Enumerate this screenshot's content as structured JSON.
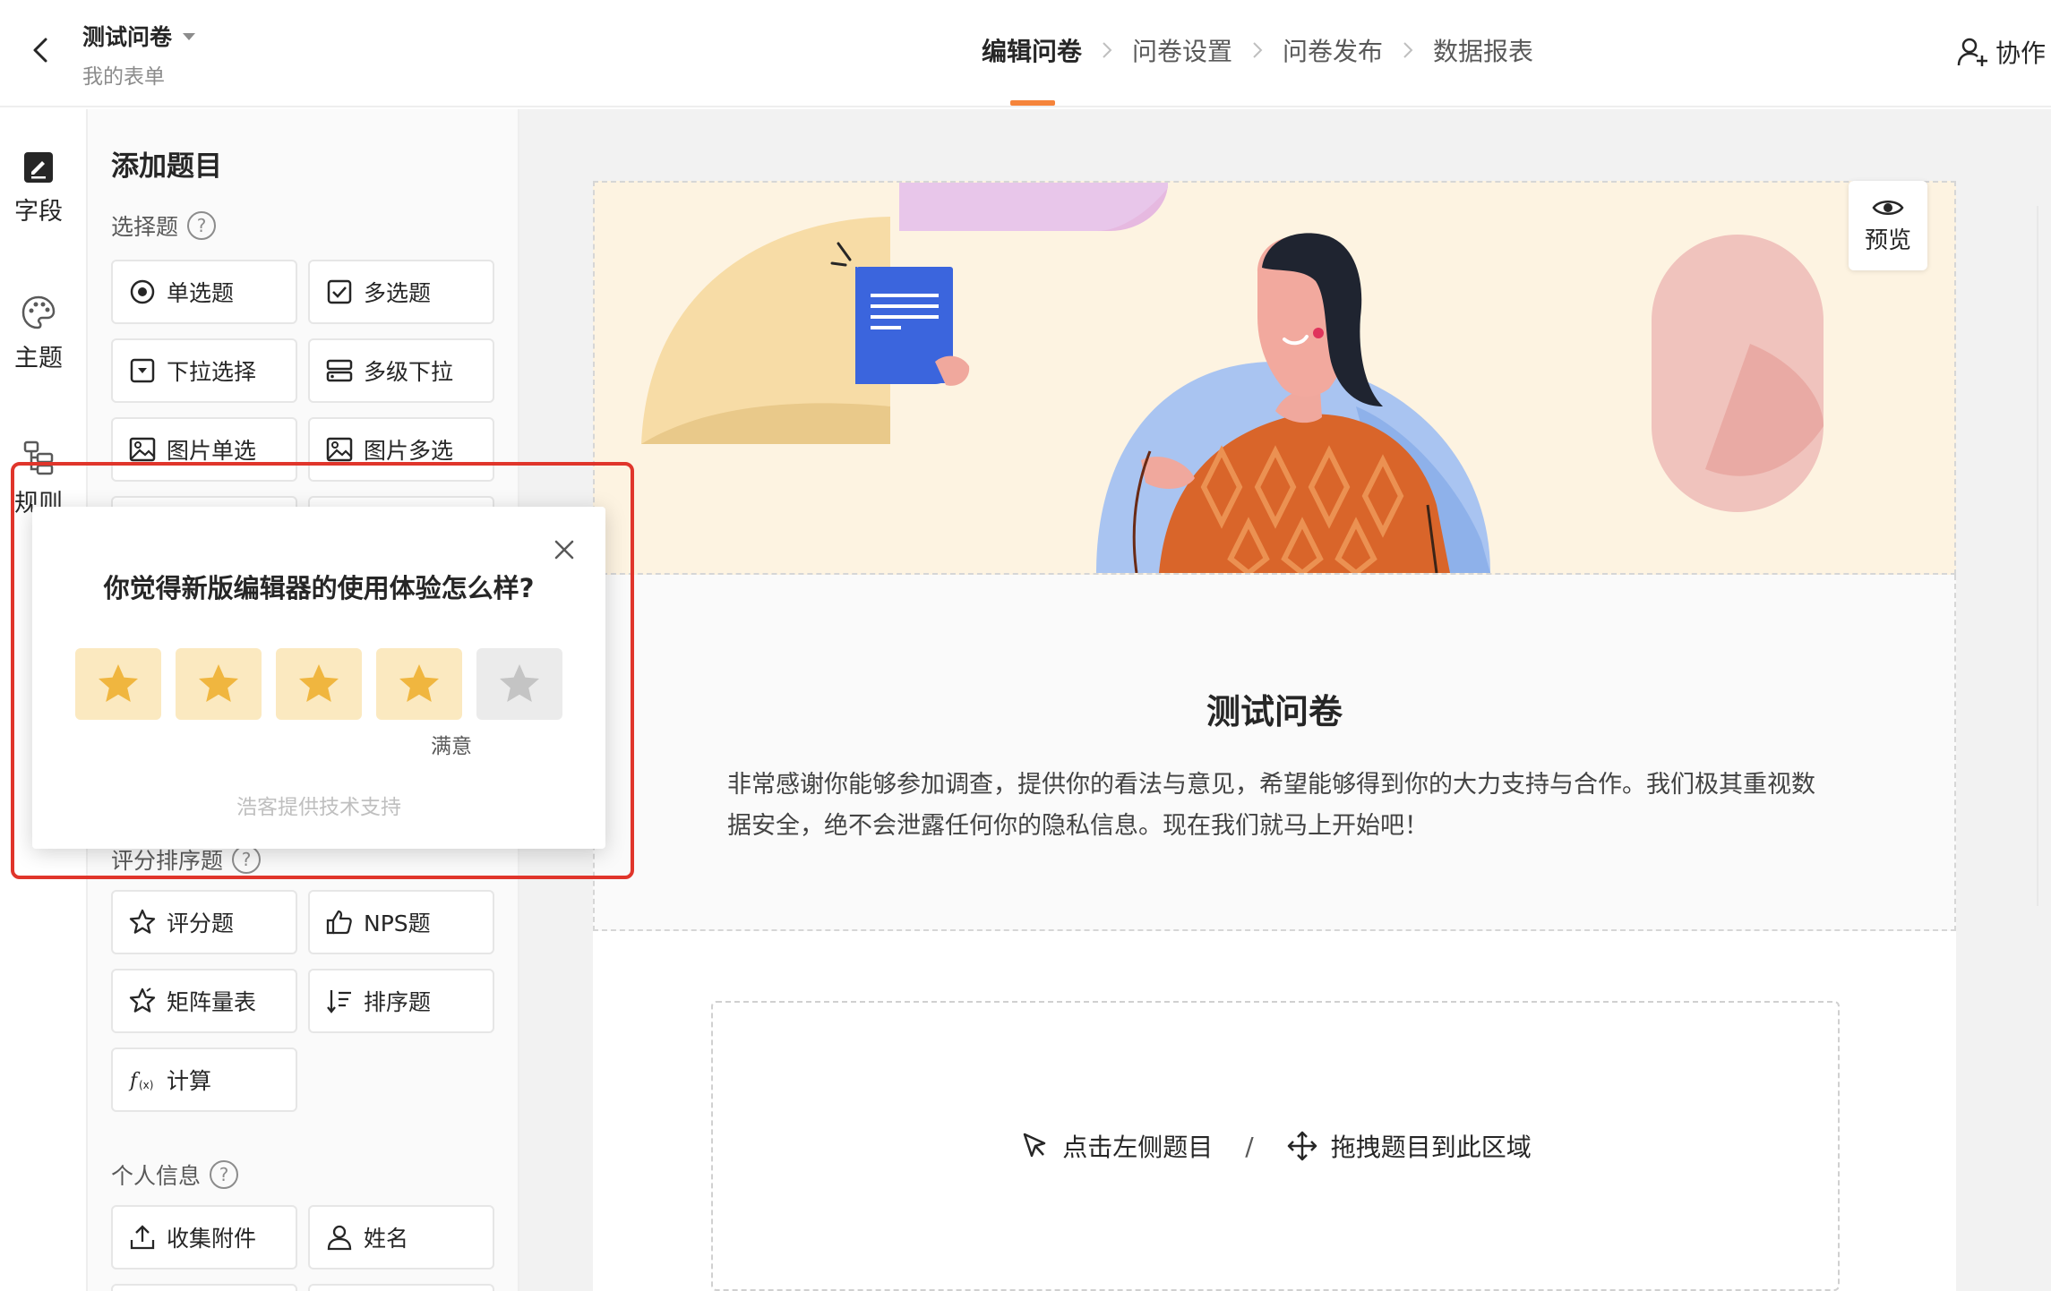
{
  "header": {
    "form_title": "测试问卷",
    "subtitle": "我的表单",
    "steps": [
      "编辑问卷",
      "问卷设置",
      "问卷发布",
      "数据报表"
    ],
    "collab_label": "协作"
  },
  "rail": {
    "items": [
      {
        "label": "字段",
        "icon": "field-edit-icon"
      },
      {
        "label": "主题",
        "icon": "palette-icon"
      },
      {
        "label": "规则",
        "icon": "rules-icon"
      }
    ]
  },
  "panel": {
    "title": "添加题目",
    "section_choice": "选择题",
    "choice_items": [
      "单选题",
      "多选题",
      "下拉选择",
      "多级下拉",
      "图片单选",
      "图片多选"
    ],
    "section_rating": "评分排序题",
    "rating_items": [
      "评分题",
      "NPS题",
      "矩阵量表",
      "排序题",
      "计算"
    ],
    "section_personal": "个人信息",
    "personal_items": [
      "收集附件",
      "姓名"
    ]
  },
  "canvas": {
    "preview_label": "预览",
    "title": "测试问卷",
    "description": "非常感谢你能够参加调查，提供你的看法与意见，希望能够得到你的大力支持与合作。我们极其重视数据安全，绝不会泄露任何你的隐私信息。现在我们就马上开始吧！",
    "drop_click": "点击左侧题目",
    "drop_separator": "/",
    "drop_drag": "拖拽题目到此区域"
  },
  "popup": {
    "question": "你觉得新版编辑器的使用体验怎么样?",
    "rating": 4,
    "max_rating": 5,
    "rating_label": "满意",
    "powered_by": "浩客提供技术支持"
  },
  "colors": {
    "accent": "#f5843b",
    "star_on": "#f0b63f",
    "star_on_bg": "#fbe9c0",
    "star_off": "#c4c4c4",
    "highlight": "#e0352b"
  }
}
